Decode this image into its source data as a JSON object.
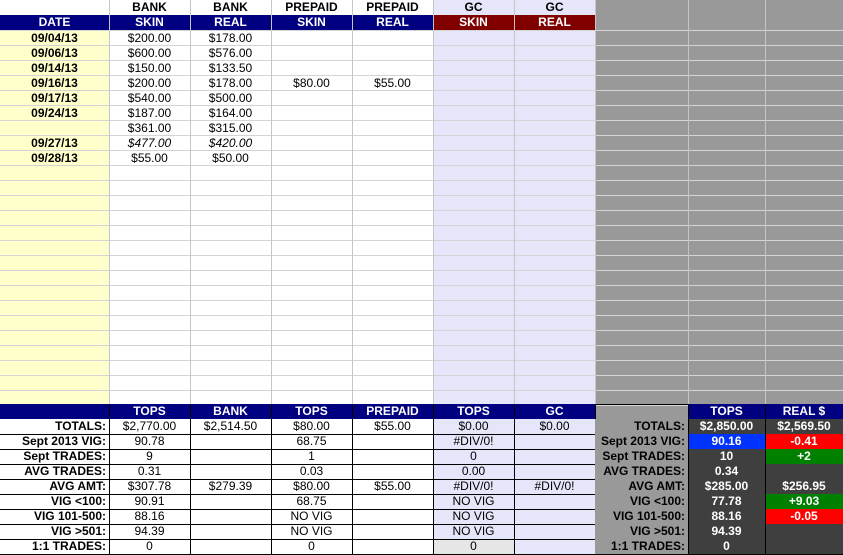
{
  "header": {
    "top": [
      "",
      "BANK",
      "BANK",
      "PREPAID",
      "PREPAID",
      "GC",
      "GC"
    ],
    "sub": [
      "DATE",
      "SKIN",
      "REAL",
      "SKIN",
      "REAL",
      "SKIN",
      "REAL"
    ]
  },
  "rows": [
    {
      "date": "09/04/13",
      "bank_skin": "$200.00",
      "bank_real": "$178.00",
      "pp_skin": "",
      "pp_real": "",
      "italic": false
    },
    {
      "date": "09/06/13",
      "bank_skin": "$600.00",
      "bank_real": "$576.00",
      "pp_skin": "",
      "pp_real": "",
      "italic": false
    },
    {
      "date": "09/14/13",
      "bank_skin": "$150.00",
      "bank_real": "$133.50",
      "pp_skin": "",
      "pp_real": "",
      "italic": false
    },
    {
      "date": "09/16/13",
      "bank_skin": "$200.00",
      "bank_real": "$178.00",
      "pp_skin": "$80.00",
      "pp_real": "$55.00",
      "italic": false
    },
    {
      "date": "09/17/13",
      "bank_skin": "$540.00",
      "bank_real": "$500.00",
      "pp_skin": "",
      "pp_real": "",
      "italic": false
    },
    {
      "date": "09/24/13",
      "bank_skin": "$187.00",
      "bank_real": "$164.00",
      "pp_skin": "",
      "pp_real": "",
      "italic": false
    },
    {
      "date": "",
      "bank_skin": "$361.00",
      "bank_real": "$315.00",
      "pp_skin": "",
      "pp_real": "",
      "italic": false
    },
    {
      "date": "09/27/13",
      "bank_skin": "$477.00",
      "bank_real": "$420.00",
      "pp_skin": "",
      "pp_real": "",
      "italic": true
    },
    {
      "date": "09/28/13",
      "bank_skin": "$55.00",
      "bank_real": "$50.00",
      "pp_skin": "",
      "pp_real": "",
      "italic": false
    }
  ],
  "summary": {
    "headers": [
      "TOPS",
      "BANK",
      "TOPS",
      "PREPAID",
      "TOPS",
      "GC"
    ],
    "rows": [
      {
        "label": "TOTALS:",
        "v": [
          "$2,770.00",
          "$2,514.50",
          "$80.00",
          "$55.00",
          "$0.00",
          "$0.00"
        ]
      },
      {
        "label": "Sept 2013 VIG:",
        "v": [
          "90.78",
          "",
          "68.75",
          "",
          "#DIV/0!",
          ""
        ]
      },
      {
        "label": "Sept TRADES:",
        "v": [
          "9",
          "",
          "1",
          "",
          "0",
          ""
        ]
      },
      {
        "label": "AVG TRADES:",
        "v": [
          "0.31",
          "",
          "0.03",
          "",
          "0.00",
          ""
        ]
      },
      {
        "label": "AVG AMT:",
        "v": [
          "$307.78",
          "$279.39",
          "$80.00",
          "$55.00",
          "#DIV/0!",
          "#DIV/0!"
        ]
      },
      {
        "label": "VIG <100:",
        "v": [
          "90.91",
          "",
          "68.75",
          "",
          "NO VIG",
          ""
        ]
      },
      {
        "label": "VIG 101-500:",
        "v": [
          "88.16",
          "",
          "NO VIG",
          "",
          "NO VIG",
          ""
        ]
      },
      {
        "label": "VIG >501:",
        "v": [
          "94.39",
          "",
          "NO VIG",
          "",
          "NO VIG",
          ""
        ]
      },
      {
        "label": "1:1 TRADES:",
        "v": [
          "0",
          "",
          "0",
          "",
          "0",
          ""
        ]
      }
    ]
  },
  "right_summary": {
    "headers": [
      "TOPS",
      "REAL $"
    ],
    "rows": [
      {
        "label": "TOTALS:",
        "tops": "$2,850.00",
        "real": "$2,569.50",
        "real_color": "#3f3f3f",
        "tops_color": "#3f3f3f"
      },
      {
        "label": "Sept 2013 VIG:",
        "tops": "90.16",
        "real": "-0.41",
        "real_color": "#ff0000",
        "tops_color": "#0033ff"
      },
      {
        "label": "Sept TRADES:",
        "tops": "10",
        "real": "+2",
        "real_color": "#008000",
        "tops_color": "#3f3f3f"
      },
      {
        "label": "AVG TRADES:",
        "tops": "0.34",
        "real": "",
        "real_color": "#3f3f3f",
        "tops_color": "#3f3f3f"
      },
      {
        "label": "AVG AMT:",
        "tops": "$285.00",
        "real": "$256.95",
        "real_color": "#3f3f3f",
        "tops_color": "#3f3f3f"
      },
      {
        "label": "VIG <100:",
        "tops": "77.78",
        "real": "+9.03",
        "real_color": "#008000",
        "tops_color": "#3f3f3f"
      },
      {
        "label": "VIG 101-500:",
        "tops": "88.16",
        "real": "-0.05",
        "real_color": "#ff0000",
        "tops_color": "#3f3f3f"
      },
      {
        "label": "VIG >501:",
        "tops": "94.39",
        "real": "",
        "real_color": "#3f3f3f",
        "tops_color": "#3f3f3f"
      },
      {
        "label": "1:1 TRADES:",
        "tops": "0",
        "real": "",
        "real_color": "#3f3f3f",
        "tops_color": "#3f3f3f"
      }
    ]
  },
  "colors": {
    "navy": "#000080",
    "dark_red": "#800000",
    "date_fill": "#ffffcc",
    "gc_fill": "#e6e6fa",
    "gray_fill": "#999999",
    "dark_cell": "#3f3f3f"
  }
}
